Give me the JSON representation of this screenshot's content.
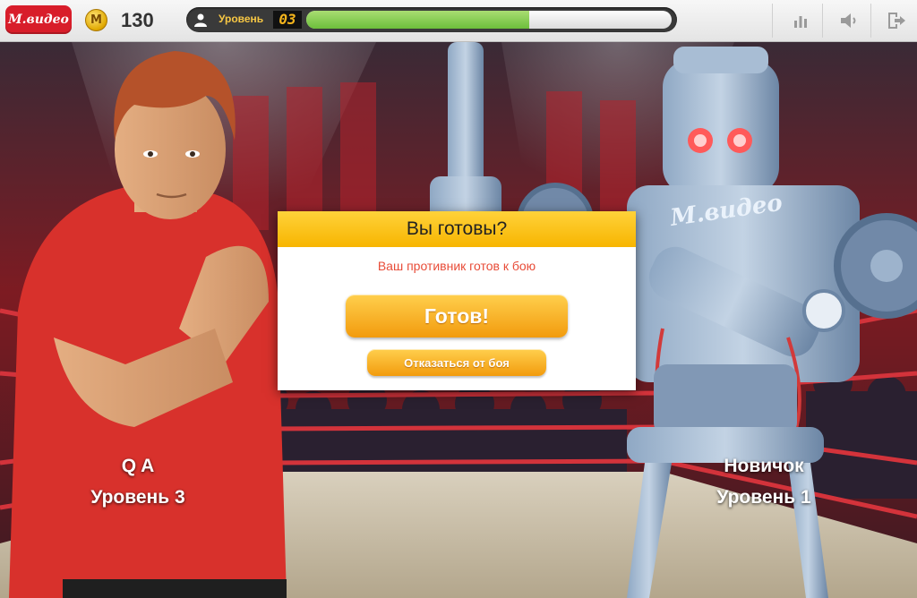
{
  "header": {
    "logo_text": "М.видео",
    "coin_symbol": "М",
    "coins": "130",
    "level_label": "Уровень",
    "level_value": "03",
    "level_progress": 0.61
  },
  "icons": {
    "user": "user-icon",
    "stats": "stats-icon",
    "sound": "sound-icon",
    "exit": "exit-icon"
  },
  "player": {
    "name": "Q A",
    "level": "Уровень 3"
  },
  "opponent": {
    "name": "Новичок",
    "level": "Уровень 1"
  },
  "dialog": {
    "title": "Вы готовы?",
    "subtitle": "Ваш противник готов к бою",
    "ready_button": "Готов!",
    "refuse_button": "Отказаться от боя"
  },
  "colors": {
    "brand_red": "#d81d2a",
    "dialog_header": "#f7b500",
    "button_orange": "#f29b0d",
    "subtitle_red": "#e84c38",
    "progress_green": "#6cbf3b"
  }
}
